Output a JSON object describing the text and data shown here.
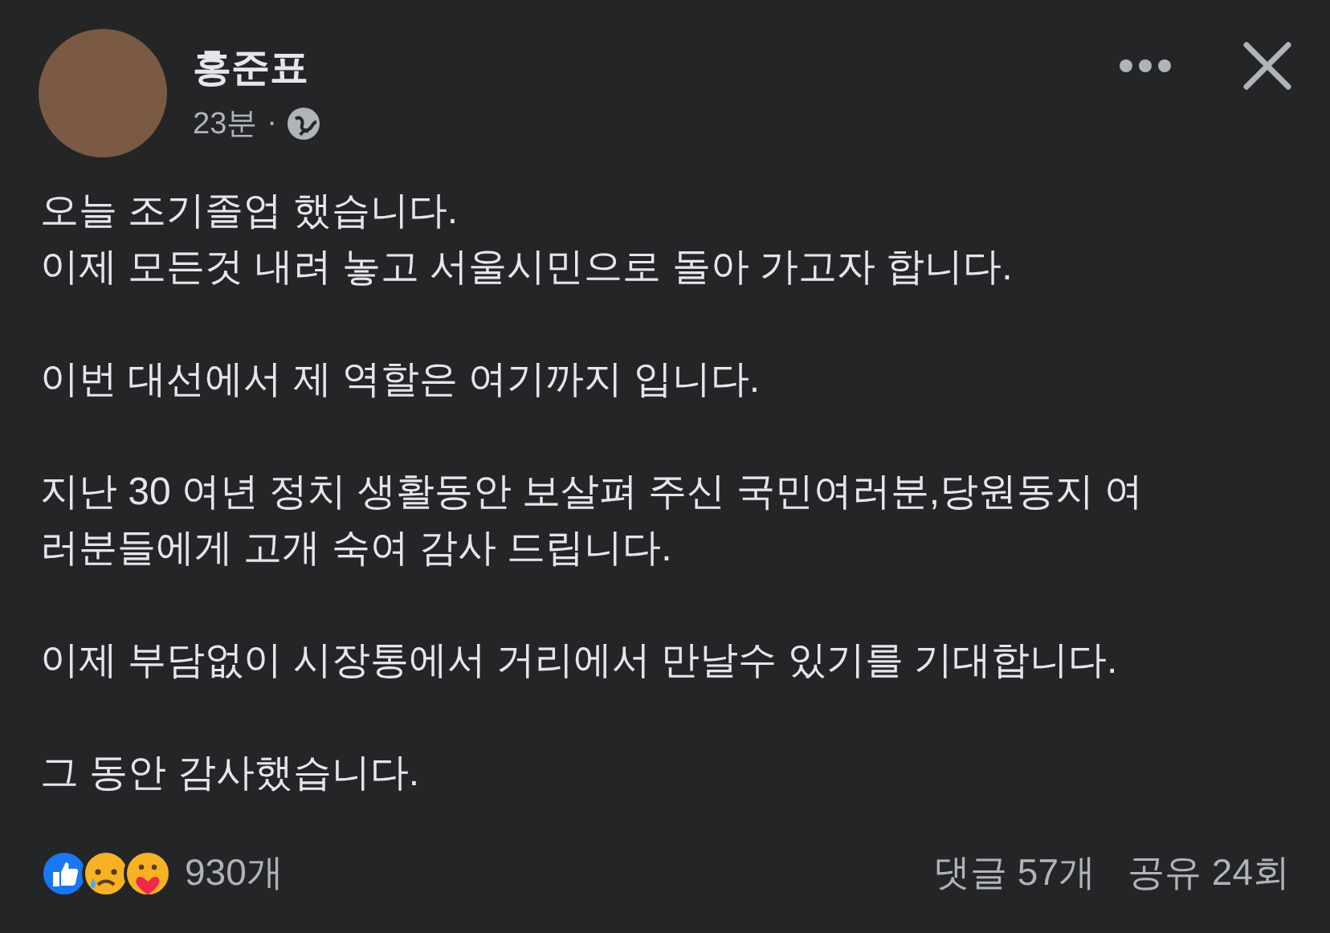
{
  "author": {
    "name": "홍준표",
    "time": "23분",
    "separator": "·"
  },
  "body": [
    {
      "lines": [
        "오늘 조기졸업 했습니다.",
        "이제 모든것 내려 놓고 서울시민으로 돌아 가고자 합니다."
      ]
    },
    {
      "lines": [
        "이번 대선에서 제 역할은 여기까지 입니다."
      ]
    },
    {
      "lines": [
        "지난 30 여년 정치 생활동안 보살펴 주신 국민여러분,당원동지 여",
        "러분들에게 고개 숙여 감사 드립니다."
      ]
    },
    {
      "lines": [
        "이제 부담없이 시장통에서 거리에서 만날수 있기를 기대합니다."
      ]
    },
    {
      "lines": [
        "그 동안 감사했습니다."
      ]
    }
  ],
  "footer": {
    "reactions": [
      {
        "kind": "like"
      },
      {
        "kind": "sad"
      },
      {
        "kind": "care"
      }
    ],
    "reaction_count": "930개",
    "comments": "댓글 57개",
    "shares": "공유 24회"
  }
}
